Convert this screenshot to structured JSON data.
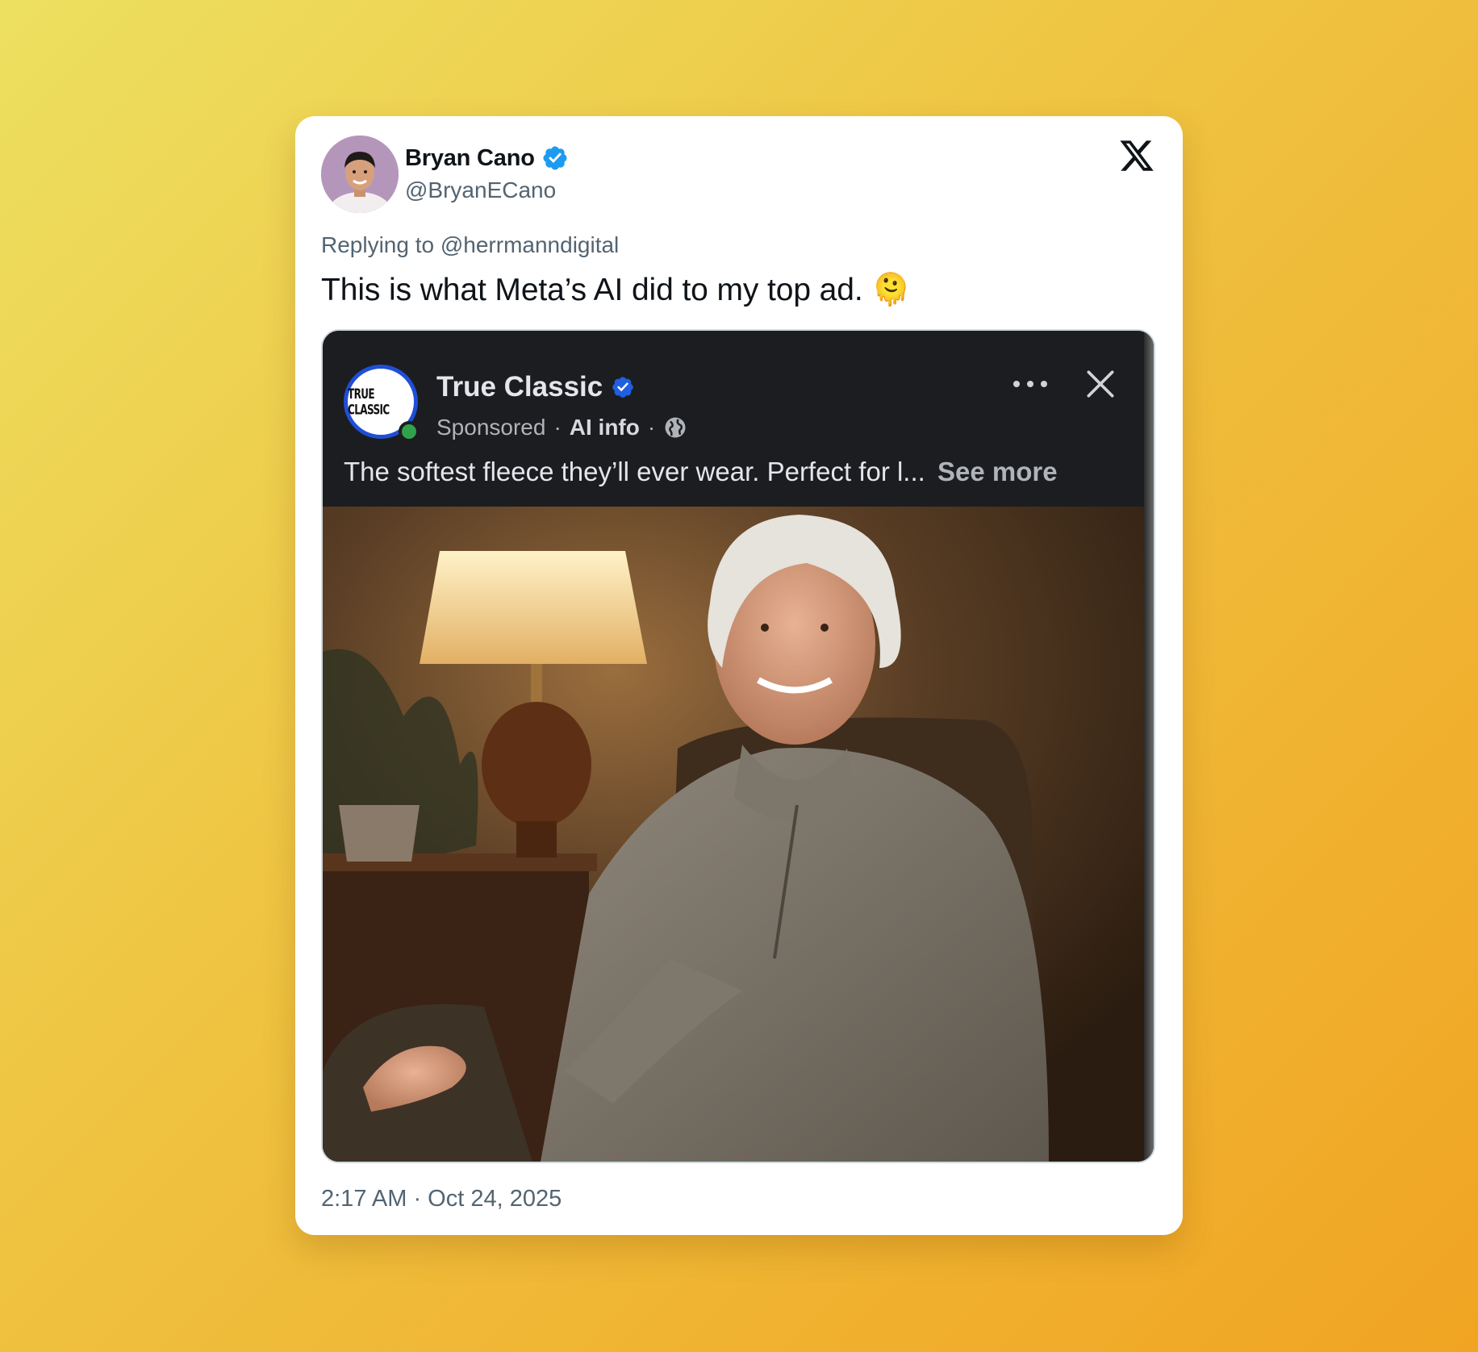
{
  "tweet": {
    "author": {
      "name": "Bryan Cano",
      "handle": "@BryanECano",
      "verified": true
    },
    "replying_to": "Replying to @herrmanndigital",
    "text": "This is what Meta’s AI did to my top ad. 🫠",
    "timestamp": "2:17 AM · Oct 24, 2025",
    "platform_icon": "x-logo-icon"
  },
  "embedded_ad": {
    "page_name": "True Classic",
    "logo_text": "TRUE CLASSIC",
    "verified": true,
    "meta": {
      "sponsored": "Sponsored",
      "separator": "·",
      "ai_info": "AI info"
    },
    "caption": "The softest fleece they’ll ever wear. Perfect for l...",
    "see_more": "See more",
    "image_description_icon": "photo-elderly-woman-fleece"
  },
  "colors": {
    "verified_blue": "#1d9bf0",
    "fb_verified_blue": "#1f5fe0",
    "fb_dark": "#1c1d20",
    "text_primary": "#0f1419",
    "text_secondary": "#536471"
  }
}
